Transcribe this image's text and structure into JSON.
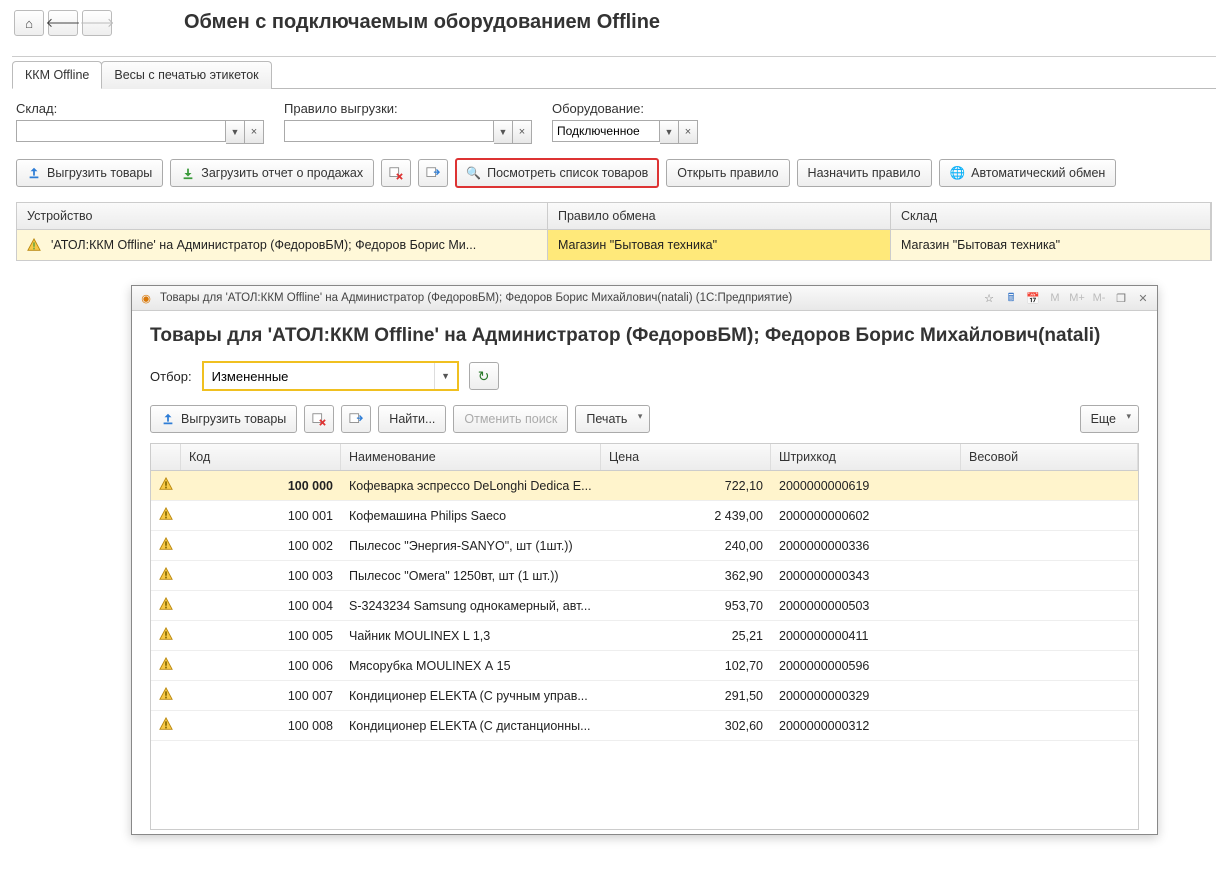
{
  "page_title": "Обмен с подключаемым оборудованием Offline",
  "tabs": [
    "ККМ Offline",
    "Весы с печатью этикеток"
  ],
  "filters": {
    "warehouse_label": "Склад:",
    "rule_label": "Правило выгрузки:",
    "equipment_label": "Оборудование:",
    "equipment_value": "Подключенное"
  },
  "toolbar": {
    "export": "Выгрузить товары",
    "load_report": "Загрузить отчет о продажах",
    "view_list": "Посмотреть список товаров",
    "open_rule": "Открыть правило",
    "assign_rule": "Назначить правило",
    "auto_exchange": "Автоматический обмен"
  },
  "grid": {
    "headers": [
      "Устройство",
      "Правило обмена",
      "Склад"
    ],
    "row": {
      "device": "'АТОЛ:ККМ Offline' на Администратор (ФедоровБМ); Федоров Борис Ми...",
      "rule": "Магазин \"Бытовая техника\"",
      "warehouse": "Магазин \"Бытовая техника\""
    }
  },
  "modal": {
    "titlebar": "Товары для 'АТОЛ:ККМ Offline' на Администратор (ФедоровБМ); Федоров Борис Михайлович(natali)  (1С:Предприятие)",
    "heading": "Товары для 'АТОЛ:ККМ Offline' на Администратор (ФедоровБМ); Федоров Борис Михайлович(natali)",
    "filter_label": "Отбор:",
    "filter_value": "Измененные",
    "toolbar": {
      "export": "Выгрузить товары",
      "find": "Найти...",
      "cancel_search": "Отменить поиск",
      "print": "Печать",
      "more": "Еще"
    },
    "columns": {
      "code": "Код",
      "name": "Наименование",
      "price": "Цена",
      "barcode": "Штрихкод",
      "weight": "Весовой"
    },
    "rows": [
      {
        "code": "100 000",
        "name": "Кофеварка эспрессо DeLonghi Dedica E...",
        "price": "722,10",
        "barcode": "2000000000619"
      },
      {
        "code": "100 001",
        "name": "Кофемашина Philips Saeco",
        "price": "2 439,00",
        "barcode": "2000000000602"
      },
      {
        "code": "100 002",
        "name": "Пылесос \"Энергия-SANYO\", шт (1шт.))",
        "price": "240,00",
        "barcode": "2000000000336"
      },
      {
        "code": "100 003",
        "name": "Пылесос \"Омега\" 1250вт, шт (1 шт.))",
        "price": "362,90",
        "barcode": "2000000000343"
      },
      {
        "code": "100 004",
        "name": "S-3243234 Samsung однокамерный, авт...",
        "price": "953,70",
        "barcode": "2000000000503"
      },
      {
        "code": "100 005",
        "name": "Чайник MOULINEX L 1,3",
        "price": "25,21",
        "barcode": "2000000000411"
      },
      {
        "code": "100 006",
        "name": "Мясорубка MOULINEX  А 15",
        "price": "102,70",
        "barcode": "2000000000596"
      },
      {
        "code": "100 007",
        "name": "Кондиционер ELEKTA (С ручным управ...",
        "price": "291,50",
        "barcode": "2000000000329"
      },
      {
        "code": "100 008",
        "name": "Кондиционер ELEKTA (С дистанционны...",
        "price": "302,60",
        "barcode": "2000000000312"
      }
    ]
  }
}
